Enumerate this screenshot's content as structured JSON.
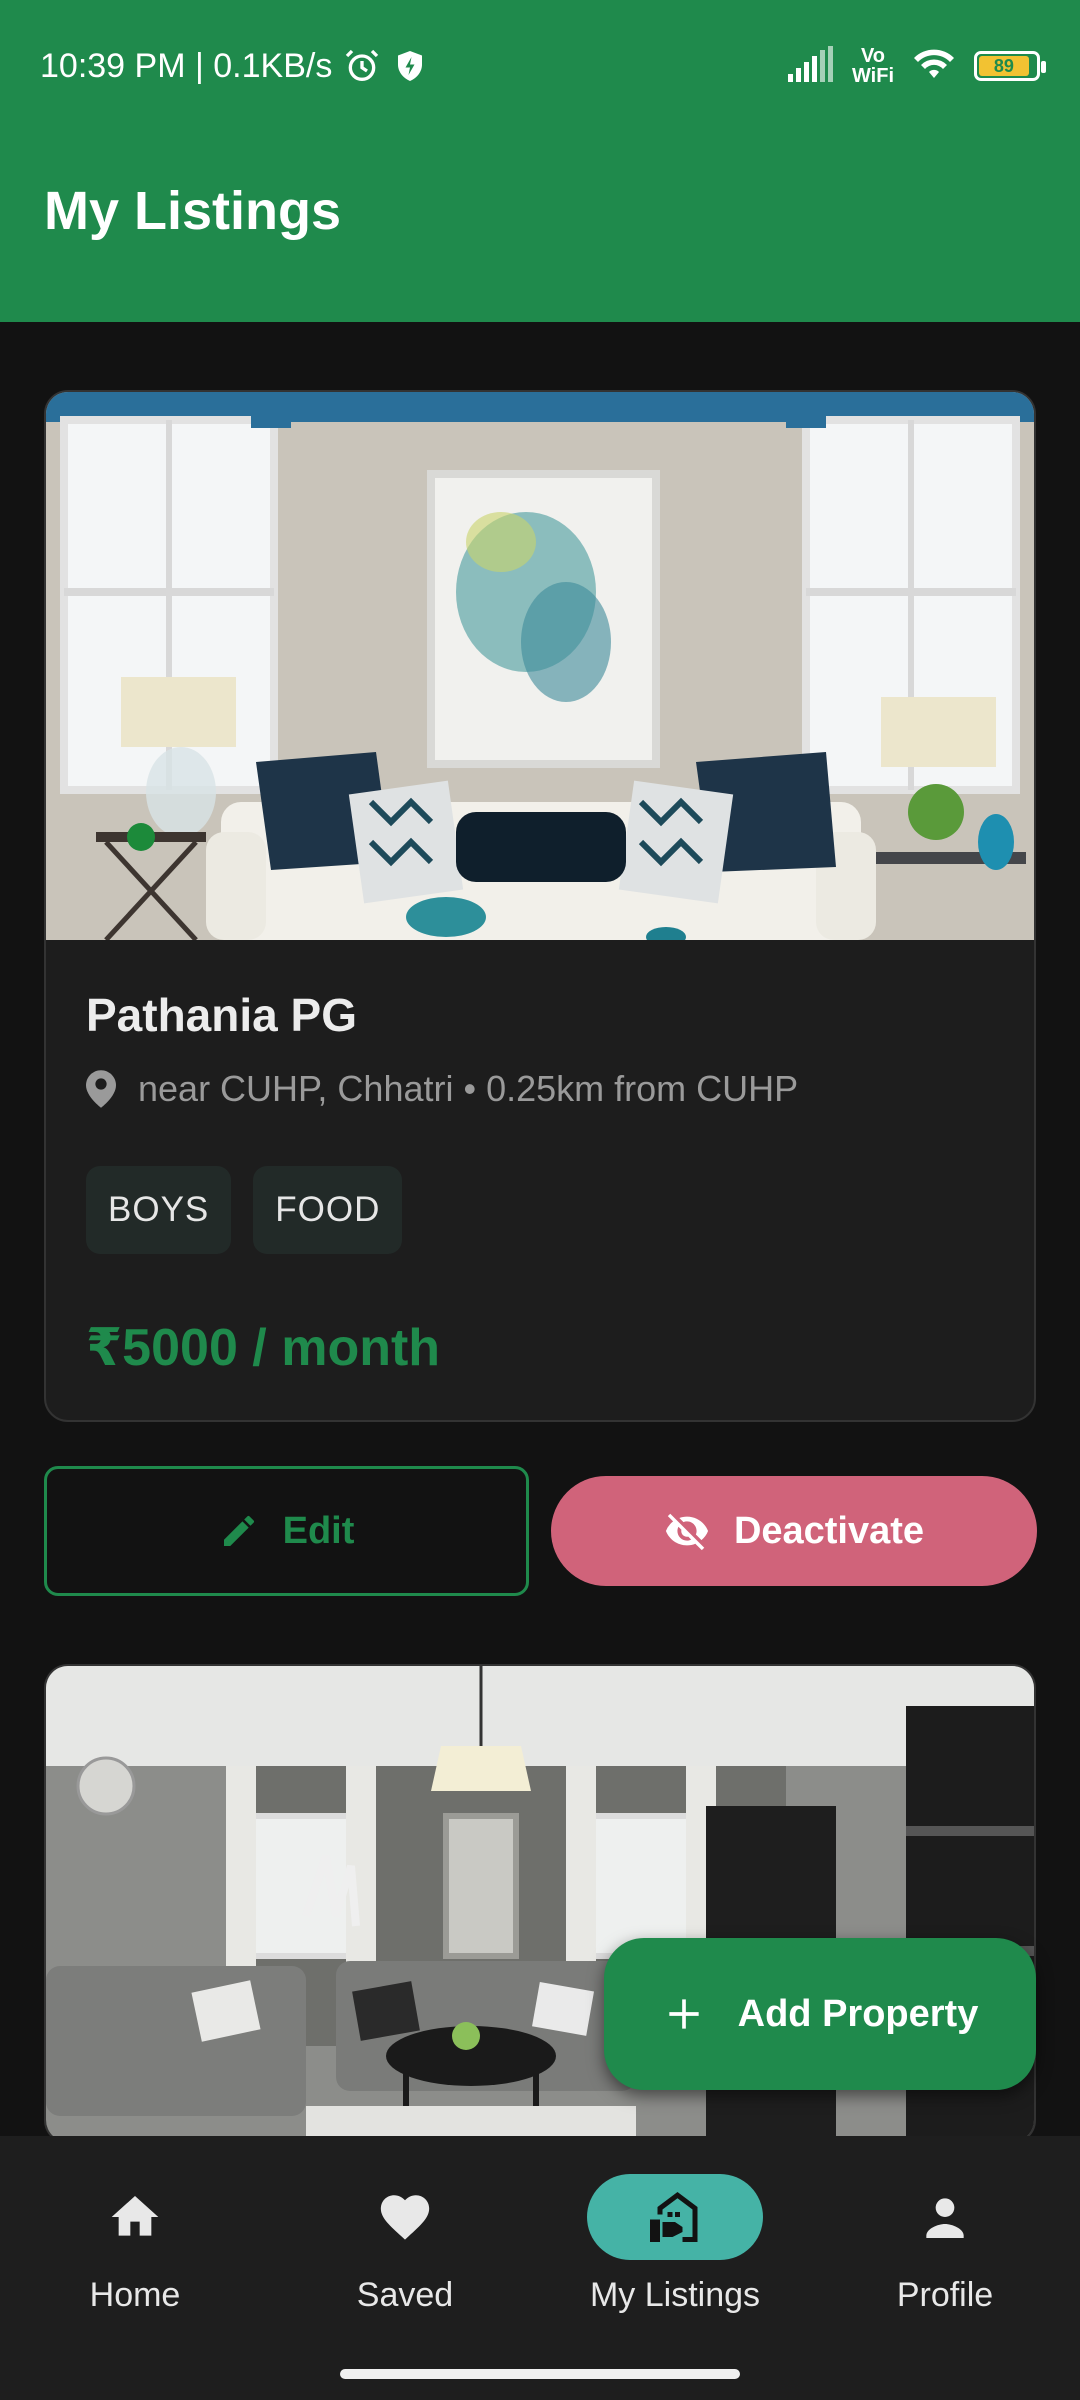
{
  "status_bar": {
    "time_speed": "10:39 PM | 0.1KB/s",
    "vowifi_top": "Vo",
    "vowifi_bottom": "WiFi",
    "battery": "89"
  },
  "header": {
    "title": "My Listings"
  },
  "listings": [
    {
      "name": "Pathania PG",
      "location": "near CUHP, Chhatri • 0.25km from CUHP",
      "tags": [
        "BOYS",
        "FOOD"
      ],
      "price": "₹5000 / month"
    }
  ],
  "actions": {
    "edit_label": "Edit",
    "deactivate_label": "Deactivate"
  },
  "fab": {
    "label": "Add Property"
  },
  "bottom_nav": {
    "items": [
      {
        "label": "Home",
        "icon": "home-icon"
      },
      {
        "label": "Saved",
        "icon": "heart-icon"
      },
      {
        "label": "My Listings",
        "icon": "listings-icon"
      },
      {
        "label": "Profile",
        "icon": "person-icon"
      }
    ],
    "active": "My Listings"
  },
  "colors": {
    "primary": "#1f8a4c",
    "danger": "#d0637a",
    "nav_active": "#45b3a6",
    "background": "#121212"
  },
  "icons": [
    "alarm-icon",
    "shield-bolt-icon",
    "signal-icon",
    "wifi-icon",
    "battery-icon",
    "location-pin-icon",
    "pencil-icon",
    "eye-off-icon",
    "plus-icon"
  ]
}
